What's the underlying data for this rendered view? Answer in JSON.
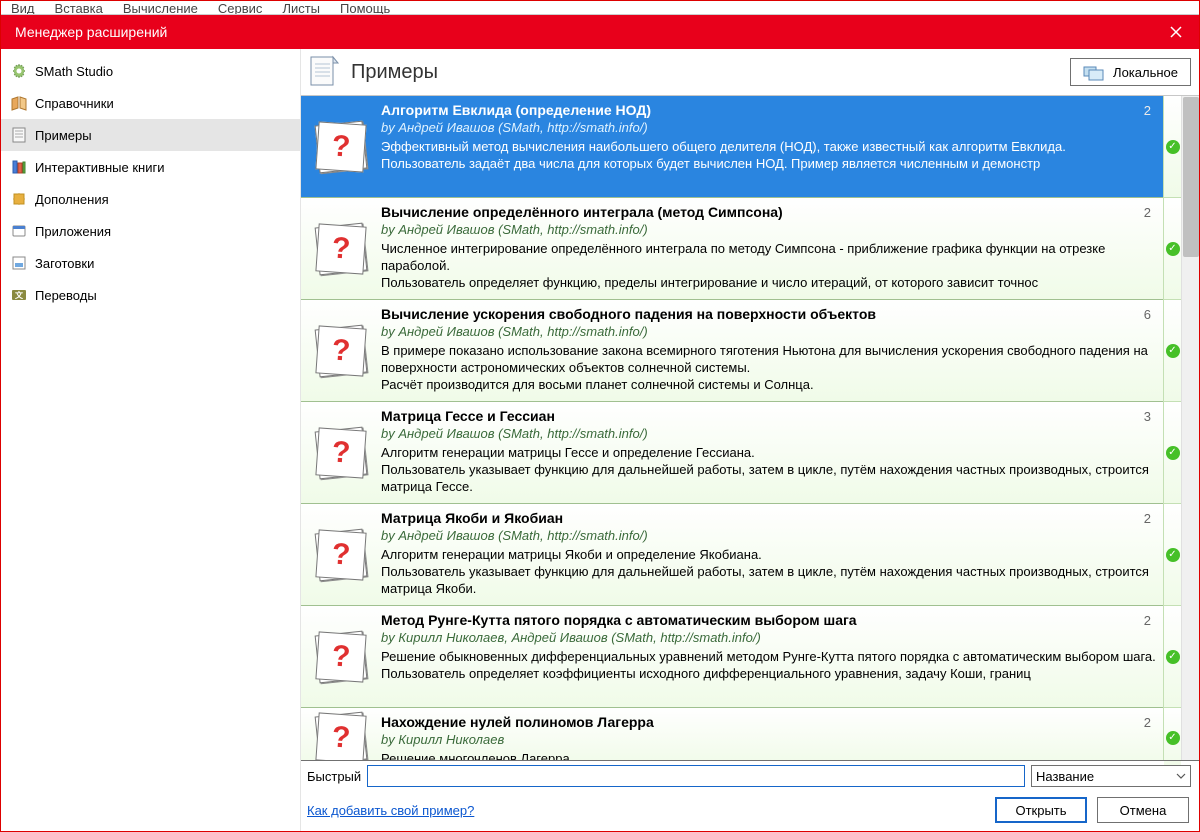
{
  "menubar": [
    "Вид",
    "Вставка",
    "Вычисление",
    "Сервис",
    "Листы",
    "Помощь"
  ],
  "window_title": "Менеджер расширений",
  "sidebar": {
    "items": [
      {
        "label": "SMath Studio"
      },
      {
        "label": "Справочники"
      },
      {
        "label": "Примеры"
      },
      {
        "label": "Интерактивные книги"
      },
      {
        "label": "Дополнения"
      },
      {
        "label": "Приложения"
      },
      {
        "label": "Заготовки"
      },
      {
        "label": "Переводы"
      }
    ]
  },
  "header": {
    "title": "Примеры",
    "location_button": "Локальное"
  },
  "list": [
    {
      "title": "Алгоритм Евклида (определение НОД)",
      "count": "2",
      "author": "by Андрей Ивашов (SMath, http://smath.info/)",
      "desc": "Эффективный метод вычисления наибольшего общего делителя (НОД), также известный как алгоритм Евклида.\nПользователь задаёт два числа для которых будет вычислен НОД. Пример является численным и демонстр",
      "selected": true
    },
    {
      "title": "Вычисление определённого интеграла (метод Симпсона)",
      "count": "2",
      "author": "by Андрей Ивашов (SMath, http://smath.info/)",
      "desc": "Численное интегрирование определённого интеграла по методу Симпсона - приближение графика функции на отрезке параболой.\nПользователь определяет функцию, пределы интегрирование и число итераций, от которого зависит точнос"
    },
    {
      "title": "Вычисление ускорения свободного падения на поверхности объектов",
      "count": "6",
      "author": "by Андрей Ивашов (SMath, http://smath.info/)",
      "desc": "В примере показано использование закона всемирного тяготения Ньютона для вычисления ускорения свободного падения на поверхности астрономических объектов солнечной системы.\nРасчёт производится для восьми планет солнечной системы и Солнца."
    },
    {
      "title": "Матрица Гессе и Гессиан",
      "count": "3",
      "author": "by Андрей Ивашов (SMath, http://smath.info/)",
      "desc": "Алгоритм генерации матрицы Гессе и определение Гессиана.\nПользователь указывает функцию для дальнейшей работы, затем в цикле, путём нахождения частных производных, строится матрица Гессе."
    },
    {
      "title": "Матрица Якоби и Якобиан",
      "count": "2",
      "author": "by Андрей Ивашов (SMath, http://smath.info/)",
      "desc": "Алгоритм генерации матрицы Якоби и определение Якобиана.\nПользователь указывает функцию для дальнейшей работы, затем в цикле, путём нахождения частных производных, строится матрица Якоби."
    },
    {
      "title": "Метод Рунге-Кутта пятого порядка с автоматическим выбором шага",
      "count": "2",
      "author": "by Кирилл Николаев, Андрей Ивашов (SMath, http://smath.info/)",
      "desc": "Решение обыкновенных дифференциальных уравнений методом Рунге-Кутта пятого порядка с автоматическим выбором шага.\nПользователь определяет коэффициенты исходного дифференциального уравнения, задачу Коши, границ"
    },
    {
      "title": "Нахождение нулей полиномов Лагерра",
      "count": "2",
      "author": "by Кирилл Николаев",
      "desc": "Решение многочленов Лагерра"
    }
  ],
  "footer": {
    "quick_label": "Быстрый",
    "combo": "Название",
    "add_link": "Как добавить свой пример?",
    "open": "Открыть",
    "cancel": "Отмена"
  }
}
